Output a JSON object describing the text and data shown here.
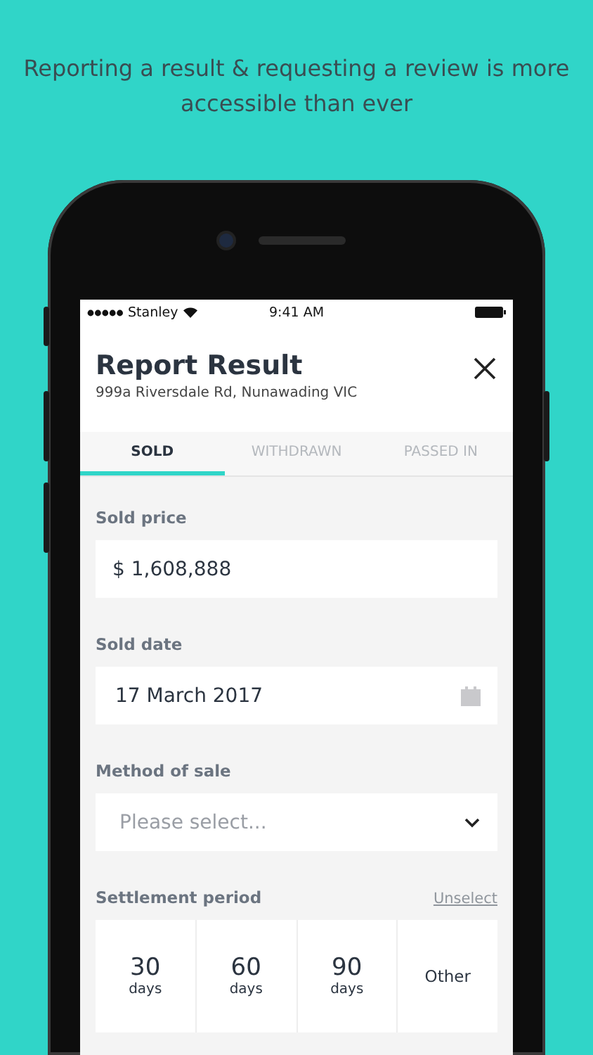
{
  "headline": "Reporting a result & requesting a review is more accessible than ever",
  "status_bar": {
    "carrier": "Stanley",
    "time": "9:41 AM"
  },
  "header": {
    "title": "Report Result",
    "address": "999a Riversdale Rd, Nunawading VIC"
  },
  "tabs": [
    {
      "label": "SOLD",
      "selected": true
    },
    {
      "label": "WITHDRAWN",
      "selected": false
    },
    {
      "label": "PASSED IN",
      "selected": false
    }
  ],
  "fields": [
    {
      "kind": "text",
      "label": "Sold price",
      "value": "$ 1,608,888"
    },
    {
      "kind": "date",
      "label": "Sold date",
      "value": "17 March 2017"
    },
    {
      "kind": "select",
      "label": "Method of sale",
      "placeholder": "Please select..."
    }
  ],
  "settlement": {
    "label": "Settlement period",
    "unselect": "Unselect",
    "options": [
      {
        "number": "30",
        "unit": "days",
        "selected": false
      },
      {
        "number": "60",
        "unit": "days",
        "selected": false
      },
      {
        "number": "90",
        "unit": "days",
        "selected": false
      },
      {
        "label": "Other",
        "selected": false
      }
    ]
  }
}
